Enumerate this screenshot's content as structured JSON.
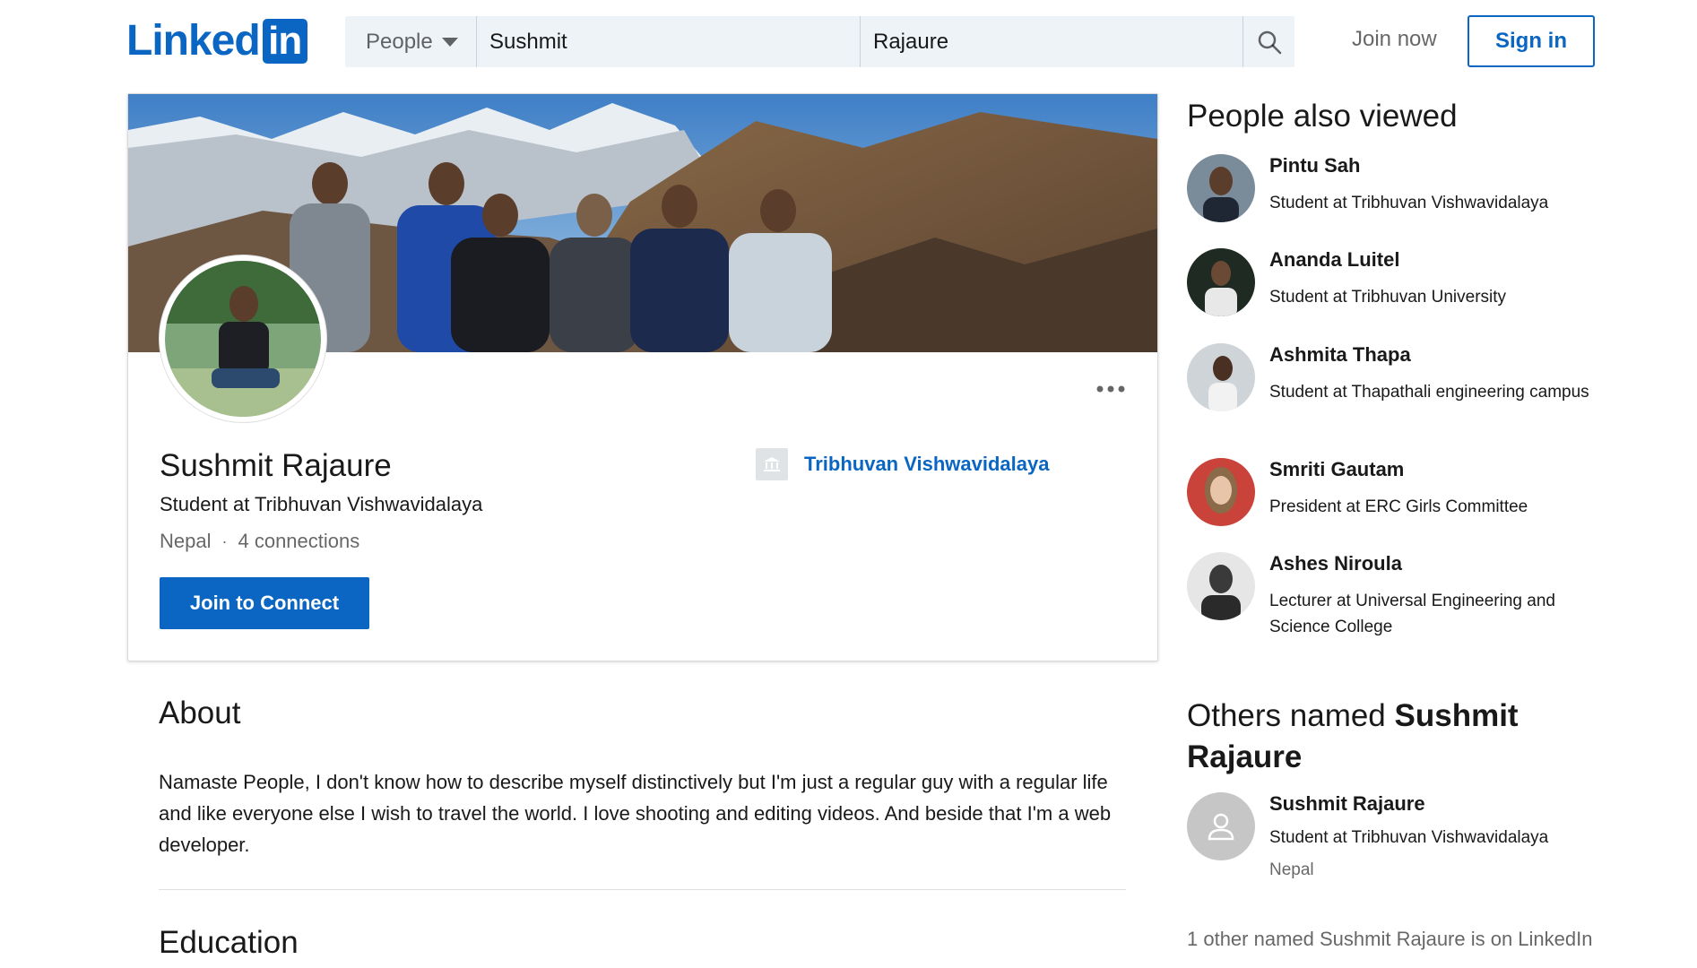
{
  "header": {
    "logo_text": "Linked",
    "logo_box_text": "in",
    "brand_color": "#0a66c2",
    "search_type": "People",
    "first_name_value": "Sushmit",
    "last_name_value": "Rajaure",
    "join_now": "Join now",
    "sign_in": "Sign in"
  },
  "profile": {
    "name": "Sushmit Rajaure",
    "headline": "Student at Tribhuvan Vishwavidalaya",
    "location": "Nepal",
    "separator": "·",
    "connections": "4 connections",
    "connect_button": "Join to Connect",
    "school": "Tribhuvan Vishwavidalaya",
    "more_icon": "ellipsis-icon"
  },
  "about": {
    "title": "About",
    "text": "Namaste People, I don't know how to describe myself distinctively but I'm just a regular guy with a regular life and like everyone else I wish to travel the world. I love shooting and editing videos. And beside that I'm a web developer."
  },
  "education": {
    "title": "Education"
  },
  "people_also_viewed": {
    "title": "People also viewed",
    "items": [
      {
        "name": "Pintu Sah",
        "headline": "Student at Tribhuvan Vishwavidalaya"
      },
      {
        "name": "Ananda Luitel",
        "headline": "Student at Tribhuvan University"
      },
      {
        "name": "Ashmita Thapa",
        "headline": "Student at Thapathali engineering campus"
      },
      {
        "name": "Smriti Gautam",
        "headline": "President at ERC Girls Committee"
      },
      {
        "name": "Ashes Niroula",
        "headline": "Lecturer at Universal Engineering and Science College"
      }
    ]
  },
  "others_named": {
    "title_prefix": "Others named",
    "title_name": "Sushmit Rajaure",
    "person": {
      "name": "Sushmit Rajaure",
      "headline": "Student at Tribhuvan Vishwavidalaya",
      "location": "Nepal"
    },
    "more_text": "1 other named Sushmit Rajaure is on LinkedIn"
  }
}
